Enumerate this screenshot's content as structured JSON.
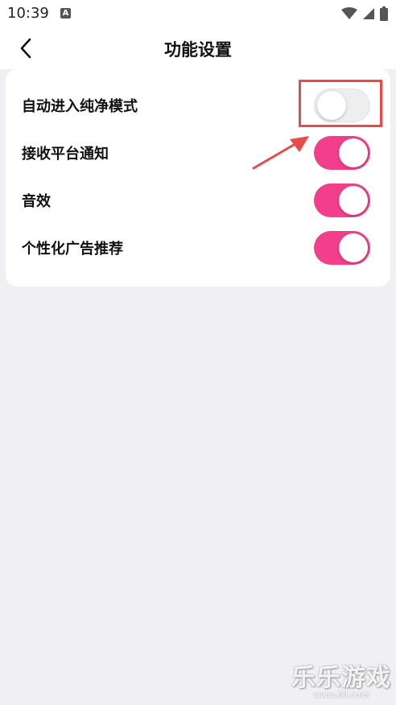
{
  "status_bar": {
    "time": "10:39",
    "notification_icon": "a-letter-icon",
    "icons": [
      "wifi-icon",
      "signal-icon",
      "battery-icon"
    ]
  },
  "header": {
    "title": "功能设置",
    "back_icon": "chevron-left-icon"
  },
  "settings": [
    {
      "label": "自动进入纯净模式",
      "enabled": false
    },
    {
      "label": "接收平台通知",
      "enabled": true
    },
    {
      "label": "音效",
      "enabled": true
    },
    {
      "label": "个性化广告推荐",
      "enabled": true
    }
  ],
  "colors": {
    "toggle_on": "#f23e8b",
    "toggle_off": "#eeeeee",
    "annotation": "#e94a4a",
    "background": "#f0f0f4"
  },
  "watermark": {
    "text": "乐乐游戏",
    "url": "www.6ll.com"
  }
}
